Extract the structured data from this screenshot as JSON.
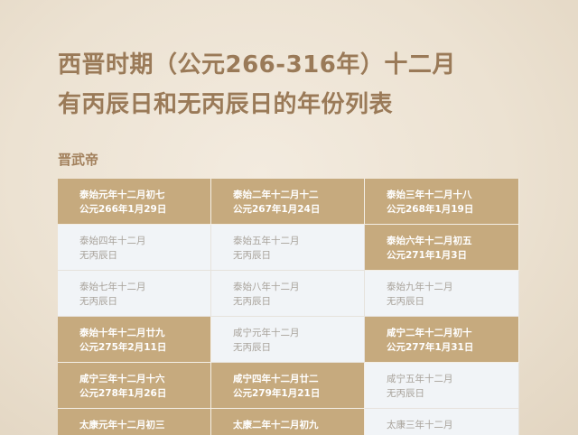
{
  "title": {
    "line1": "西晋时期（公元266-316年）十二月",
    "line2": "有丙辰日和无丙辰日的年份列表"
  },
  "section": {
    "heading": "晋武帝"
  },
  "years": [
    {
      "name": "泰始元年十二月初七",
      "detail": "公元266年1月29日",
      "has_bingchen": true
    },
    {
      "name": "泰始二年十二月十二",
      "detail": "公元267年1月24日",
      "has_bingchen": true
    },
    {
      "name": "泰始三年十二月十八",
      "detail": "公元268年1月19日",
      "has_bingchen": true
    },
    {
      "name": "泰始四年十二月",
      "detail": "无丙辰日",
      "has_bingchen": false
    },
    {
      "name": "泰始五年十二月",
      "detail": "无丙辰日",
      "has_bingchen": false
    },
    {
      "name": "泰始六年十二月初五",
      "detail": "公元271年1月3日",
      "has_bingchen": true
    },
    {
      "name": "泰始七年十二月",
      "detail": "无丙辰日",
      "has_bingchen": false
    },
    {
      "name": "泰始八年十二月",
      "detail": "无丙辰日",
      "has_bingchen": false
    },
    {
      "name": "泰始九年十二月",
      "detail": "无丙辰日",
      "has_bingchen": false
    },
    {
      "name": "泰始十年十二月廿九",
      "detail": "公元275年2月11日",
      "has_bingchen": true
    },
    {
      "name": "咸宁元年十二月",
      "detail": "无丙辰日",
      "has_bingchen": false
    },
    {
      "name": "咸宁二年十二月初十",
      "detail": "公元277年1月31日",
      "has_bingchen": true
    },
    {
      "name": "咸宁三年十二月十六",
      "detail": "公元278年1月26日",
      "has_bingchen": true
    },
    {
      "name": "咸宁四年十二月廿二",
      "detail": "公元279年1月21日",
      "has_bingchen": true
    },
    {
      "name": "咸宁五年十二月",
      "detail": "无丙辰日",
      "has_bingchen": false
    },
    {
      "name": "太康元年十二月初三",
      "detail": "",
      "has_bingchen": true
    },
    {
      "name": "太康二年十二月初九",
      "detail": "",
      "has_bingchen": true
    },
    {
      "name": "太康三年十二月",
      "detail": "",
      "has_bingchen": false
    }
  ],
  "colors": {
    "has_cell": "#c6aa7e",
    "none_cell": "#f1f4f7",
    "title": "#9a7a58"
  }
}
